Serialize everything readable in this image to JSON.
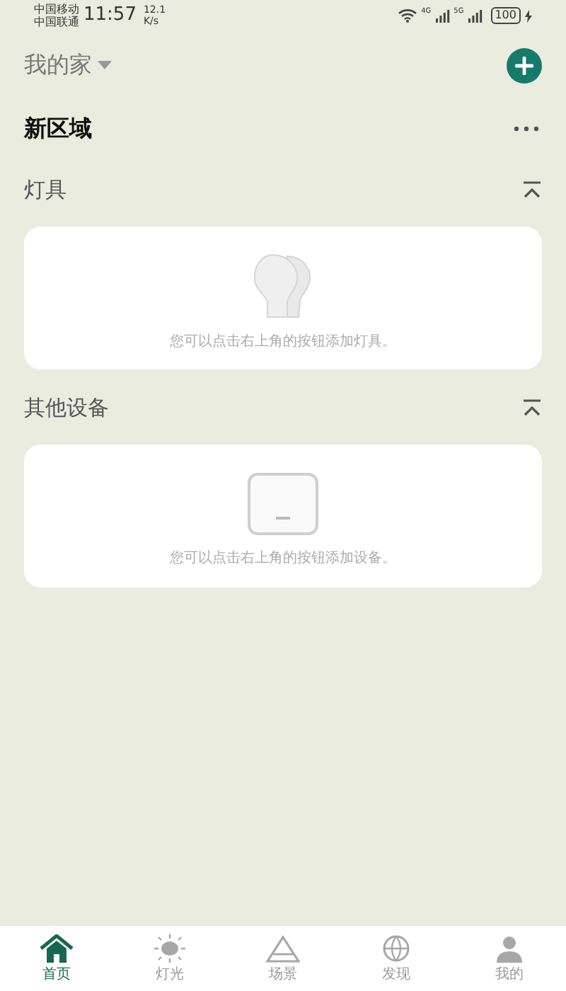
{
  "status_bar": {
    "carriers": [
      "中国移动",
      "中国联通"
    ],
    "time": "11:57",
    "speed": [
      "12.1",
      "K/s"
    ],
    "signal_labels": [
      "4G",
      "5G"
    ],
    "battery": "100"
  },
  "header": {
    "home": "我的家"
  },
  "area": {
    "title": "新区域"
  },
  "sections": [
    {
      "title": "灯具",
      "kind": "lamp",
      "empty_text": "您可以点击右上角的按钮添加灯具。"
    },
    {
      "title": "其他设备",
      "kind": "device",
      "empty_text": "您可以点击右上角的按钮添加设备。"
    }
  ],
  "tabs": [
    {
      "label": "首页",
      "kind": "home",
      "selected": true
    },
    {
      "label": "灯光",
      "kind": "light",
      "selected": false
    },
    {
      "label": "场景",
      "kind": "scene",
      "selected": false
    },
    {
      "label": "发现",
      "kind": "discover",
      "selected": false
    },
    {
      "label": "我的",
      "kind": "me",
      "selected": false
    }
  ]
}
